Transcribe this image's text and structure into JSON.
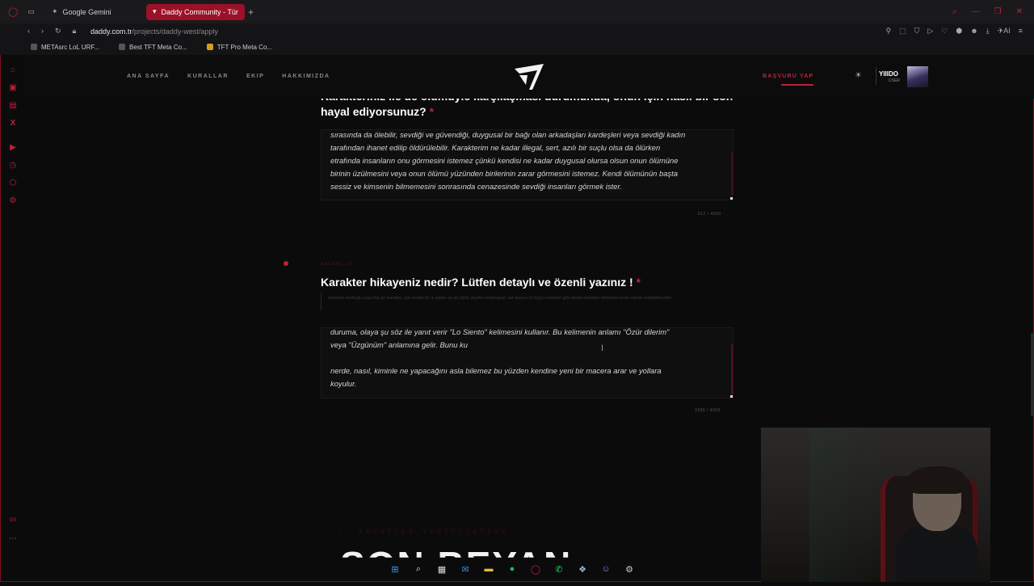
{
  "browser": {
    "tabs": [
      {
        "label": "Google Gemini",
        "active": false
      },
      {
        "label": "Daddy Community - Türkiy",
        "active": true
      }
    ],
    "url_host": "daddy.com.tr",
    "url_path": "/projects/daddy-west/apply",
    "bookmarks": [
      "METAsrc LoL URF...",
      "Best TFT Meta Co...",
      "TFT Pro Meta Co..."
    ],
    "accent": "#c0203a"
  },
  "site": {
    "nav": [
      "ANA SAYFA",
      "KURALLAR",
      "EKIP",
      "HAKKIMIZDA"
    ],
    "apply": "BAŞVURU YAP",
    "user_name": "YIIIDO",
    "user_role": "USER"
  },
  "question1": {
    "title_line1": "Karakteriniz ile de ölümüyle karşılaşması durumunda, onun için nasıl bir son",
    "title_line2": "hayal ediyorsunuz?",
    "required": "*",
    "answer": [
      "sırasında da ölebilir, sevdiği ve güvendiği, duygusal bir bağı olan arkadaşları kardeşleri veya sevdiği kadın",
      "tarafından ihanet edilip öldürülebilir. Karakterim ne kadar illegal, sert, azılı bir suçlu olsa da ölürken",
      "etrafında insanların onu görmesini istemez çünkü kendisi ne kadar duygusal olursa olsun onun ölümüne",
      "birinin üzülmesini veya onun ölümü yüzünden birilerinin zarar görmesini istemez. Kendi ölümünün başta",
      "sessiz ve kimsenin bilmemesini sonrasında cenazesinde sevdiği insanları görmek ister."
    ],
    "counter": "612 / 4000"
  },
  "question2": {
    "record": "RECORD_10",
    "title": "Karakter hikayeniz nedir? Lütfen detaylı ve özenli yazınız !",
    "required": "*",
    "hint": "Herkesin korktuğu yaşa dışı bir karakter, çok zengin bir iş adamı ya da hiçbir şeyden korkmayan, tek başına 15 kişiyi vurabilen gibi abartılı karakter hikâyeleri kesin olarak reddedilecektir!",
    "answer": [
      "duruma, olaya şu söz ile yanıt verir \"Lo Siento\" kelimesini kullanır. Bu kelimenin anlamı \"Özür dilerim\"",
      "veya \"Üzgünüm\" anlamına gelir. Bunu ku",
      "",
      "nerde, nasıl, kiminle ne yapacağını asla bilemez bu yüzden kendine yeni bir macera arar ve yollara",
      "koyulur."
    ],
    "counter": "2388 / 4000"
  },
  "section": {
    "label": "// FRONTIER_VERIFICATION",
    "big_title": "SON BEYAN"
  }
}
